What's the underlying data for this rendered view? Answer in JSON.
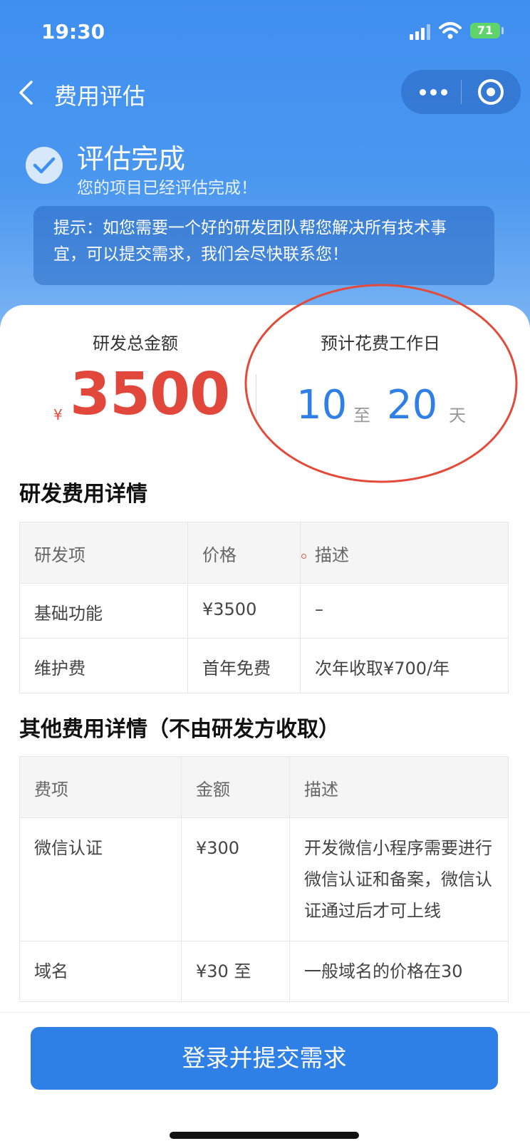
{
  "status_bar": {
    "time": "19:30",
    "battery": "71"
  },
  "nav": {
    "title": "费用评估"
  },
  "assessment": {
    "title": "评估完成",
    "subtitle": "您的项目已经评估完成！",
    "tip": "提示：如您需要一个好的研发团队帮您解决所有技术事宜，可以提交需求，我们会尽快联系您！"
  },
  "summary": {
    "total_label": "研发总金额",
    "currency": "¥",
    "total_amount": "3500",
    "days_label": "预计花费工作日",
    "days_min": "10",
    "days_sep": "至",
    "days_max": "20",
    "days_unit": "天"
  },
  "dev_fees": {
    "title": "研发费用详情",
    "headers": [
      "研发项",
      "价格",
      "描述"
    ],
    "rows": [
      [
        "基础功能",
        "¥3500",
        "–"
      ],
      [
        "维护费",
        "首年免费",
        "次年收取¥700/年"
      ]
    ]
  },
  "other_fees": {
    "title": "其他费用详情（不由研发方收取）",
    "headers": [
      "费项",
      "金额",
      "描述"
    ],
    "rows": [
      [
        "微信认证",
        "¥300",
        "开发微信小程序需要进行微信认证和备案，微信认证通过后才可上线"
      ],
      [
        "域名",
        "¥30 至",
        "一般域名的价格在30"
      ]
    ]
  },
  "actions": {
    "submit": "登录并提交需求"
  },
  "colors": {
    "primary": "#2f80e6",
    "amount_red": "#e2473b",
    "annotation_red": "#e34a3a"
  }
}
